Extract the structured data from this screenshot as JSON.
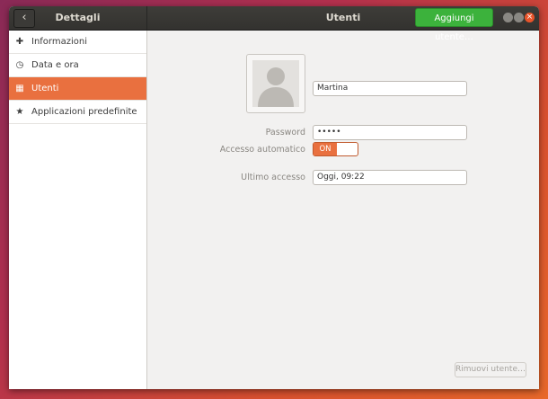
{
  "header": {
    "back_glyph": "‹",
    "left_title": "Dettagli",
    "right_title": "Utenti",
    "add_user_label": "Aggiungi utente…",
    "close_glyph": "×"
  },
  "sidebar": {
    "items": [
      {
        "label": "Informazioni",
        "icon": "plus-icon",
        "glyph": "✚",
        "active": false
      },
      {
        "label": "Data e ora",
        "icon": "clock-icon",
        "glyph": "◷",
        "active": false
      },
      {
        "label": "Utenti",
        "icon": "users-icon",
        "glyph": "▦",
        "active": true
      },
      {
        "label": "Applicazioni predefinite",
        "icon": "star-icon",
        "glyph": "★",
        "active": false
      }
    ]
  },
  "user": {
    "name": "Martina",
    "password_label": "Password",
    "password_value": "•••••",
    "autologin_label": "Accesso automatico",
    "autologin_state": "ON",
    "last_login_label": "Ultimo accesso",
    "last_login_value": "Oggi, 09:22"
  },
  "footer": {
    "remove_user_label": "Rimuovi utente…"
  },
  "colors": {
    "accent": "#e9703f",
    "add_button": "#3cb23c",
    "header_bg": "#3b3a37"
  }
}
